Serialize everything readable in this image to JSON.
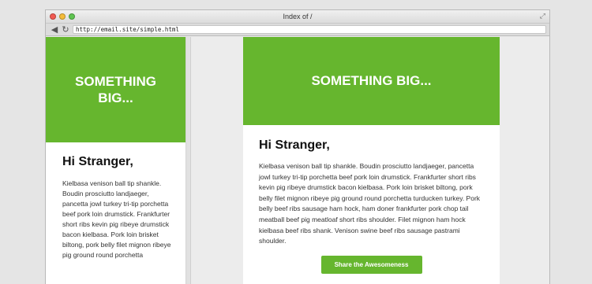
{
  "window": {
    "title": "Index of /",
    "url": "http://email.site/simple.html"
  },
  "colors": {
    "accent": "#66b62e"
  },
  "icons": {
    "back": "back-arrow-icon",
    "reload": "reload-icon",
    "resize": "fullscreen-icon"
  },
  "mobile": {
    "hero_title": "SOMETHING BIG...",
    "greeting": "Hi Stranger,",
    "body": "Kielbasa venison ball tip shankle. Boudin prosciutto landjaeger, pancetta jowl turkey tri-tip porchetta beef pork loin drumstick. Frankfurter short ribs kevin pig ribeye drumstick bacon kielbasa. Pork loin brisket biltong, pork belly filet mignon ribeye pig ground round porchetta"
  },
  "desktop": {
    "hero_title": "SOMETHING BIG...",
    "greeting": "Hi Stranger,",
    "body": "Kielbasa venison ball tip shankle. Boudin prosciutto landjaeger, pancetta jowl turkey tri-tip porchetta beef pork loin drumstick. Frankfurter short ribs kevin pig ribeye drumstick bacon kielbasa. Pork loin brisket biltong, pork belly filet mignon ribeye pig ground round porchetta turducken turkey. Pork belly beef ribs sausage ham hock, ham doner frankfurter pork chop tail meatball beef pig meatloaf short ribs shoulder. Filet mignon ham hock kielbasa beef ribs shank. Venison swine beef ribs sausage pastrami shoulder.",
    "cta_label": "Share the Awesomeness"
  }
}
